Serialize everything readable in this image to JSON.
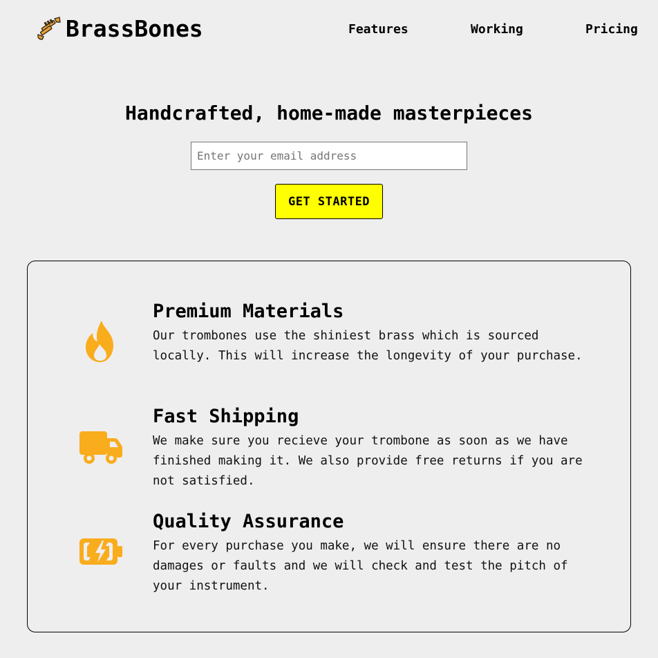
{
  "header": {
    "brand_name": "BrassBones",
    "logo_icon": "trumpet-icon",
    "nav": {
      "features": "Features",
      "working": "Working",
      "pricing": "Pricing"
    }
  },
  "hero": {
    "title": "Handcrafted, home-made masterpieces",
    "email_placeholder": "Enter your email address",
    "cta_label": "GET STARTED"
  },
  "features": {
    "items": [
      {
        "icon": "flame-icon",
        "title": "Premium Materials",
        "description": "Our trombones use the shiniest brass which is sourced locally. This will increase the longevity of your purchase."
      },
      {
        "icon": "truck-icon",
        "title": "Fast Shipping",
        "description": "We make sure you recieve your trombone as soon as we have finished making it. We also provide free returns if you are not satisfied."
      },
      {
        "icon": "battery-bolt-icon",
        "title": "Quality Assurance",
        "description": "For every purchase you make, we will ensure there are no damages or faults and we will check and test the pitch of your instrument."
      }
    ]
  },
  "colors": {
    "background": "#eeeeee",
    "accent_icon": "#f9ac1c",
    "cta_background": "#ffff00"
  }
}
